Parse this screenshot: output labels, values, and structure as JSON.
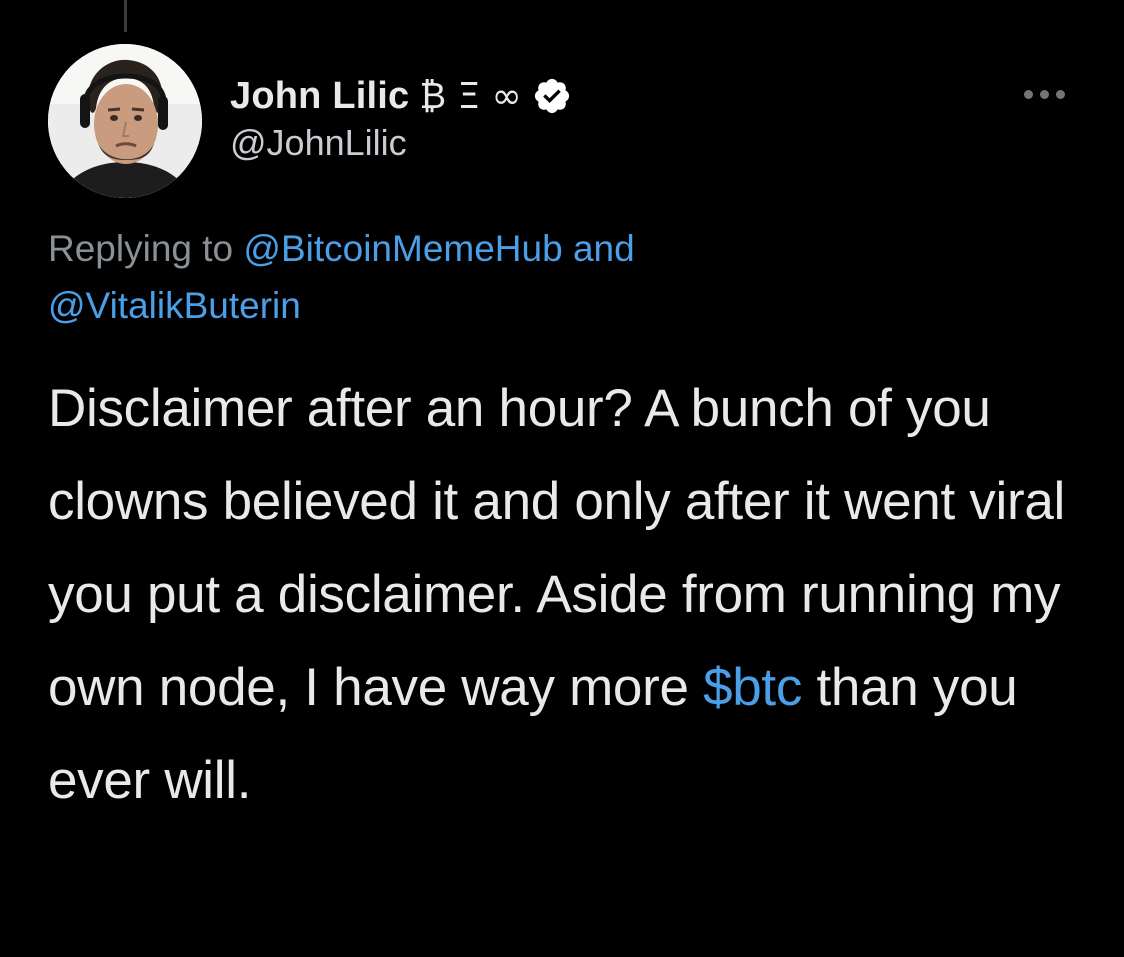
{
  "colors": {
    "background": "#000000",
    "text_primary": "#e7e9ea",
    "text_secondary": "#8b9096",
    "link": "#4a9fe8",
    "verified_badge": "#ffffff"
  },
  "author": {
    "display_name": "John Lilic",
    "name_symbols": "₿ Ξ ∞",
    "handle": "@JohnLilic",
    "verified_icon": "verified-badge-icon",
    "avatar_icon": "avatar-photo"
  },
  "more_options_icon": "more-horizontal-icon",
  "reply_context": {
    "prefix": "Replying to",
    "mention_1": "@BitcoinMemeHub",
    "conjunction": "and",
    "mention_2": "@VitalikButerin"
  },
  "tweet": {
    "text_before_cashtag": "Disclaimer after an hour? A bunch of you clowns believed it and only after it went viral you put a disclaimer. Aside from running my own node, I have way more",
    "cashtag": "$btc",
    "text_after_cashtag": "than you ever will."
  }
}
